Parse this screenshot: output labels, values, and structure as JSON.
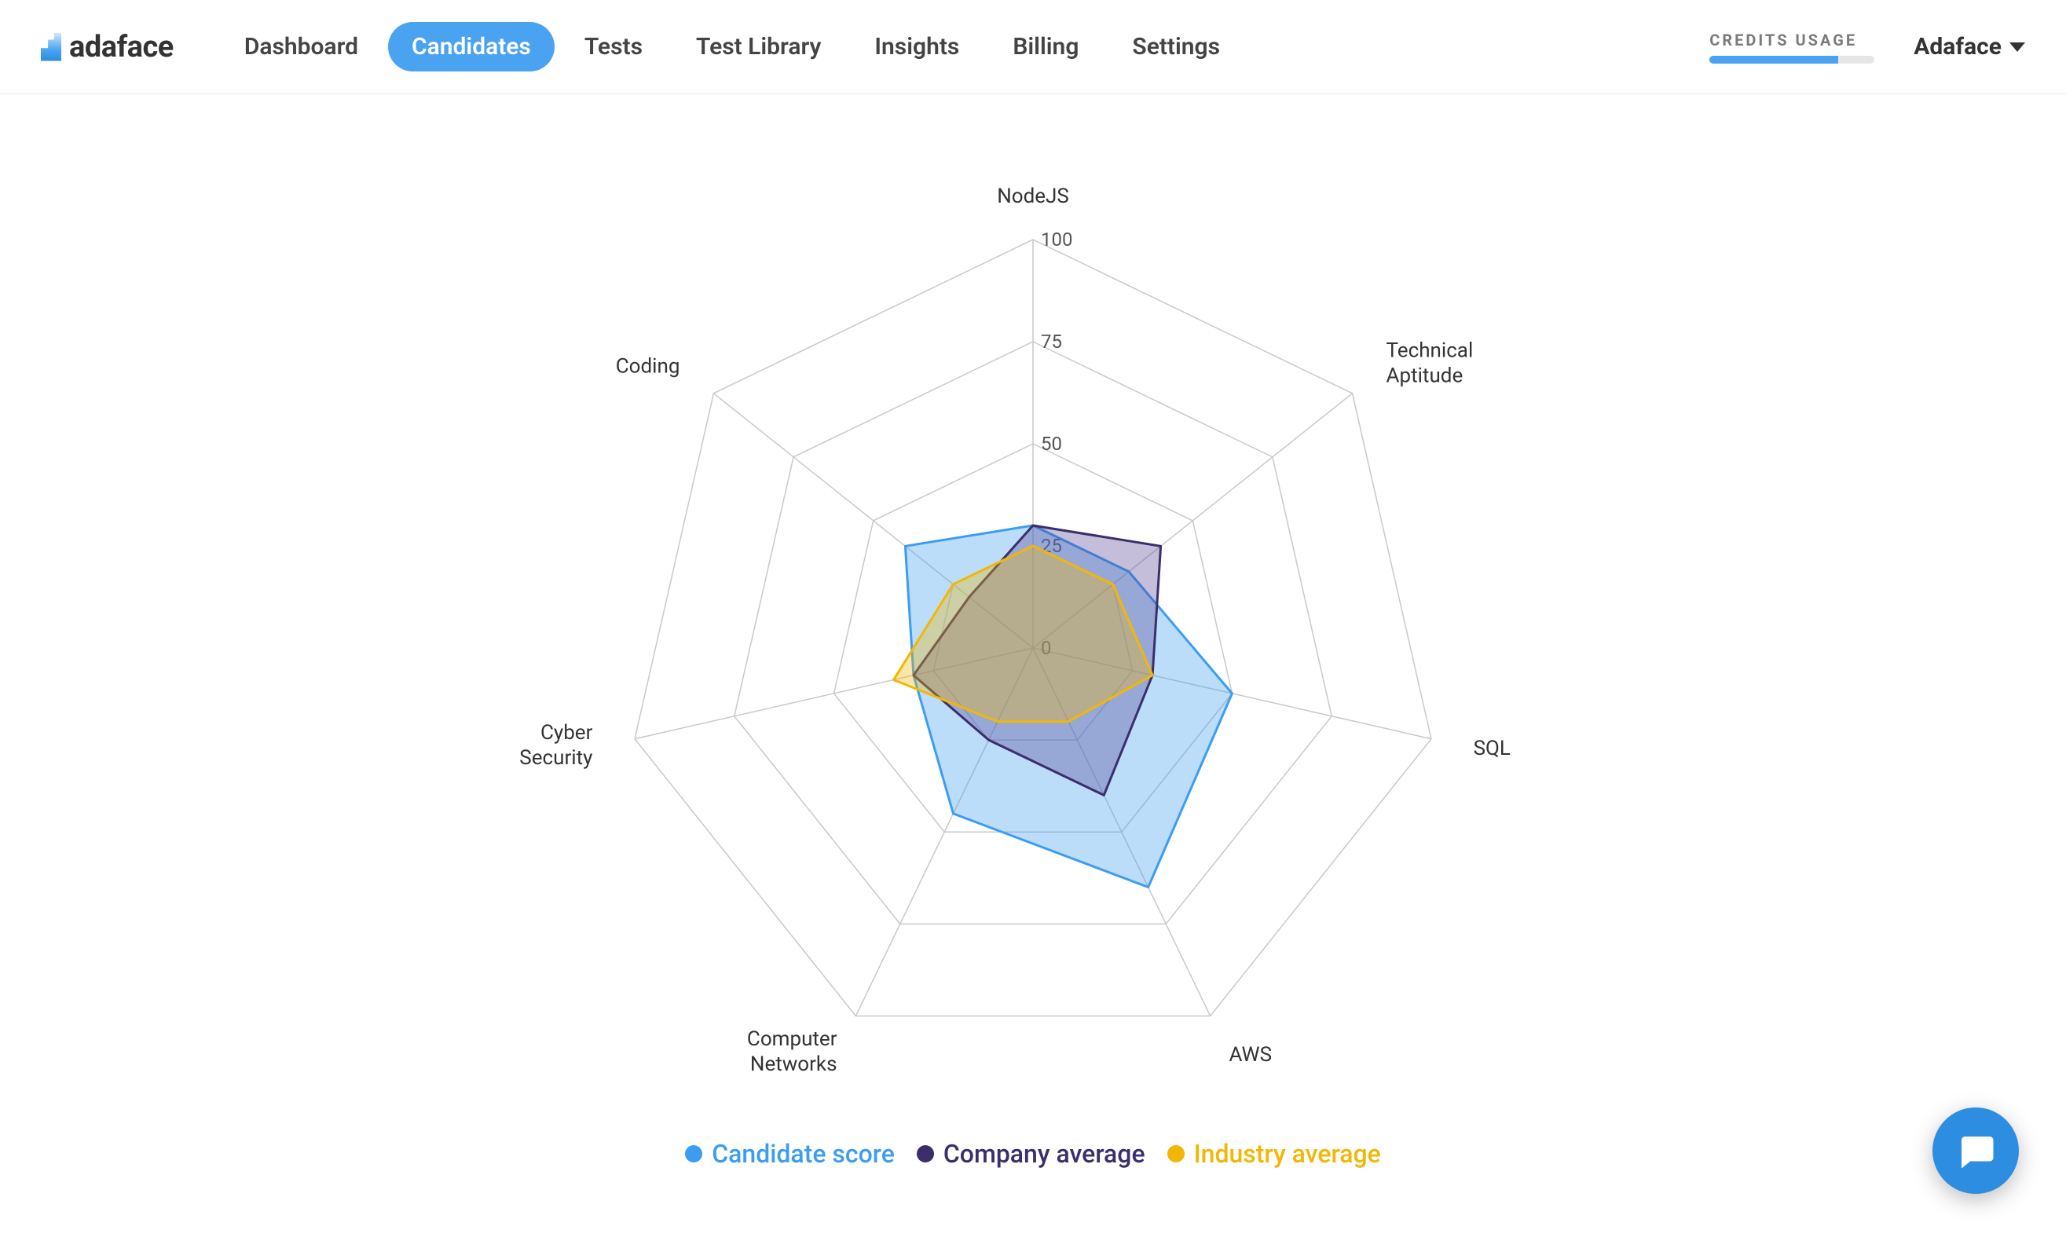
{
  "brand": {
    "name": "adaface"
  },
  "nav": {
    "items": [
      {
        "label": "Dashboard",
        "active": false
      },
      {
        "label": "Candidates",
        "active": true
      },
      {
        "label": "Tests",
        "active": false
      },
      {
        "label": "Test Library",
        "active": false
      },
      {
        "label": "Insights",
        "active": false
      },
      {
        "label": "Billing",
        "active": false
      },
      {
        "label": "Settings",
        "active": false
      }
    ]
  },
  "credits": {
    "label": "CREDITS USAGE",
    "percent": 78
  },
  "account": {
    "label": "Adaface"
  },
  "colors": {
    "candidate": {
      "stroke": "#3b9df2",
      "fill": "rgba(59,157,242,0.35)",
      "dot": "#3b9df2"
    },
    "company": {
      "stroke": "#3b2e6b",
      "fill": "rgba(86,70,150,0.35)",
      "dot": "#3b2e6b"
    },
    "industry": {
      "stroke": "#f2b705",
      "fill": "rgba(242,183,5,0.35)",
      "dot": "#f2b705"
    }
  },
  "chart_data": {
    "type": "radar",
    "categories": [
      "NodeJS",
      "Technical Aptitude",
      "SQL",
      "AWS",
      "Computer Networks",
      "Cyber Security",
      "Coding"
    ],
    "ticks": [
      0,
      25,
      50,
      75,
      100
    ],
    "ylim": [
      0,
      100
    ],
    "series": [
      {
        "name": "Candidate score",
        "color_key": "candidate",
        "values": [
          30,
          30,
          50,
          65,
          45,
          30,
          40
        ]
      },
      {
        "name": "Company average",
        "color_key": "company",
        "values": [
          30,
          40,
          30,
          40,
          25,
          30,
          20
        ]
      },
      {
        "name": "Industry average",
        "color_key": "industry",
        "values": [
          25,
          25,
          30,
          20,
          20,
          35,
          25
        ]
      }
    ],
    "legend_position": "bottom",
    "grid": true
  }
}
